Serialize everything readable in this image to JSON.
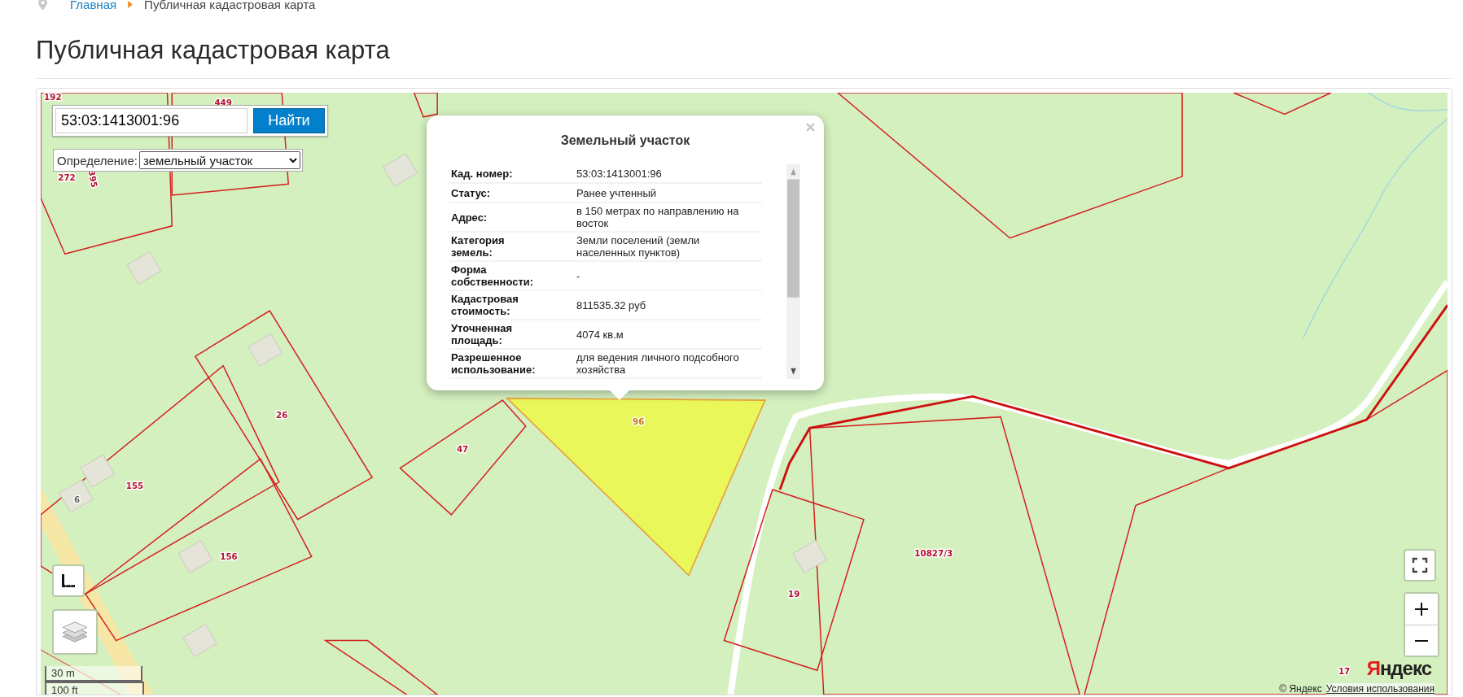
{
  "breadcrumb": [
    {
      "label": "Главная",
      "kind": "link"
    },
    {
      "label": "Публичная кадастровая карта",
      "kind": "current"
    }
  ],
  "title": "Публичная кадастровая карта",
  "search": {
    "value": "53:03:1413001:96",
    "button": "Найти"
  },
  "definition": {
    "label": "Определение:",
    "value": "земельный участок"
  },
  "map_labels": [
    {
      "text": "192",
      "kind": "parcel"
    },
    {
      "text": "449",
      "kind": "parcel"
    },
    {
      "text": "272",
      "kind": "parcel"
    },
    {
      "text": "395",
      "kind": "parcel"
    },
    {
      "text": "26",
      "kind": "parcel"
    },
    {
      "text": "155",
      "kind": "parcel"
    },
    {
      "text": "6",
      "kind": "building"
    },
    {
      "text": "156",
      "kind": "parcel"
    },
    {
      "text": "47",
      "kind": "parcel"
    },
    {
      "text": "96",
      "kind": "selected"
    },
    {
      "text": "19",
      "kind": "parcel"
    },
    {
      "text": "10827/3",
      "kind": "parcel"
    },
    {
      "text": "17",
      "kind": "parcel"
    }
  ],
  "popup": {
    "title": "Земельный участок",
    "rows": [
      {
        "label": "Кад. номер:",
        "value": "53:03:1413001:96"
      },
      {
        "label": "Статус:",
        "value": "Ранее учтенный"
      },
      {
        "label": "Адрес:",
        "value": "в 150 метрах по направлению на восток"
      },
      {
        "label": "Категория земель:",
        "value": "Земли поселений (земли населенных пунктов)"
      },
      {
        "label": "Форма собственности:",
        "value": "-"
      },
      {
        "label": "Кадастровая стоимость:",
        "value": "811535.32 руб"
      },
      {
        "label": "Уточненная площадь:",
        "value": "4074 кв.м"
      },
      {
        "label": "Разрешенное использование:",
        "value": "для ведения личного подсобного хозяйства"
      }
    ]
  },
  "scale": [
    "30 m",
    "100 ft"
  ],
  "attribution": {
    "logo": "Яндекс",
    "copyright": "© Яндекс",
    "terms": "Условия использования"
  }
}
